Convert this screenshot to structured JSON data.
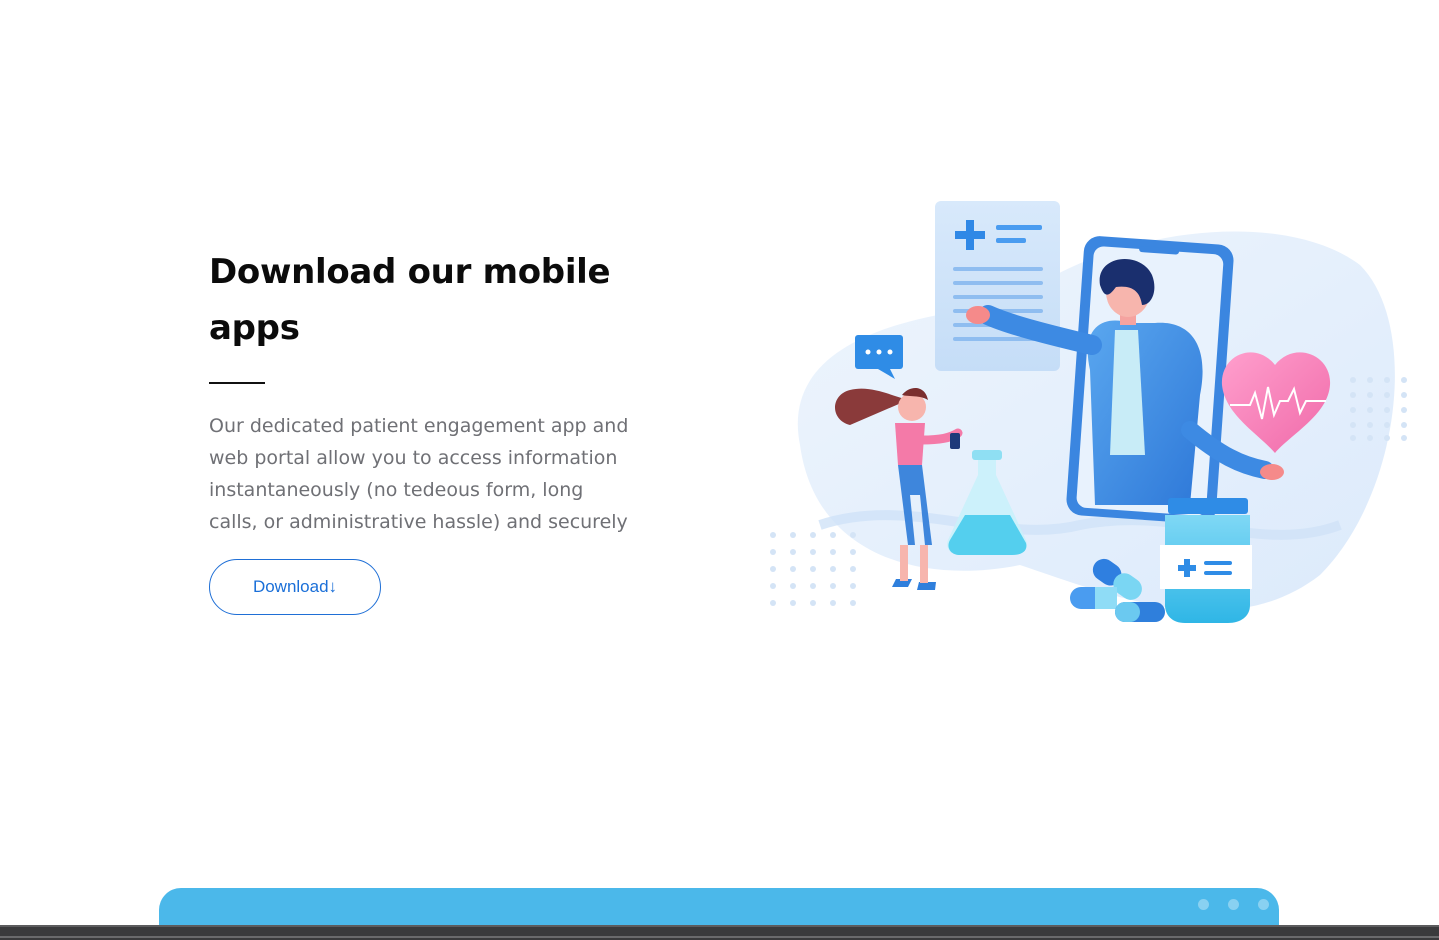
{
  "section": {
    "title": "Download our mobile apps",
    "description": "Our dedicated patient engagement app and web portal allow you to access information instantaneously (no tedeous form, long calls, or administrative hassle) and securely",
    "download_button_label": "Download↓"
  },
  "illustration": {
    "name": "telemedicine-illustration",
    "icons": [
      "medical-report-icon",
      "chat-bubble-icon",
      "heart-pulse-icon",
      "flask-icon",
      "medicine-bottle-icon",
      "pill-capsule-icon"
    ]
  },
  "carousel": {
    "dots_count": 3
  },
  "colors": {
    "accent": "#1a6fd8",
    "card_blue": "#4bb8ea",
    "title": "#0b0b0b",
    "body_text": "#6f7075"
  }
}
